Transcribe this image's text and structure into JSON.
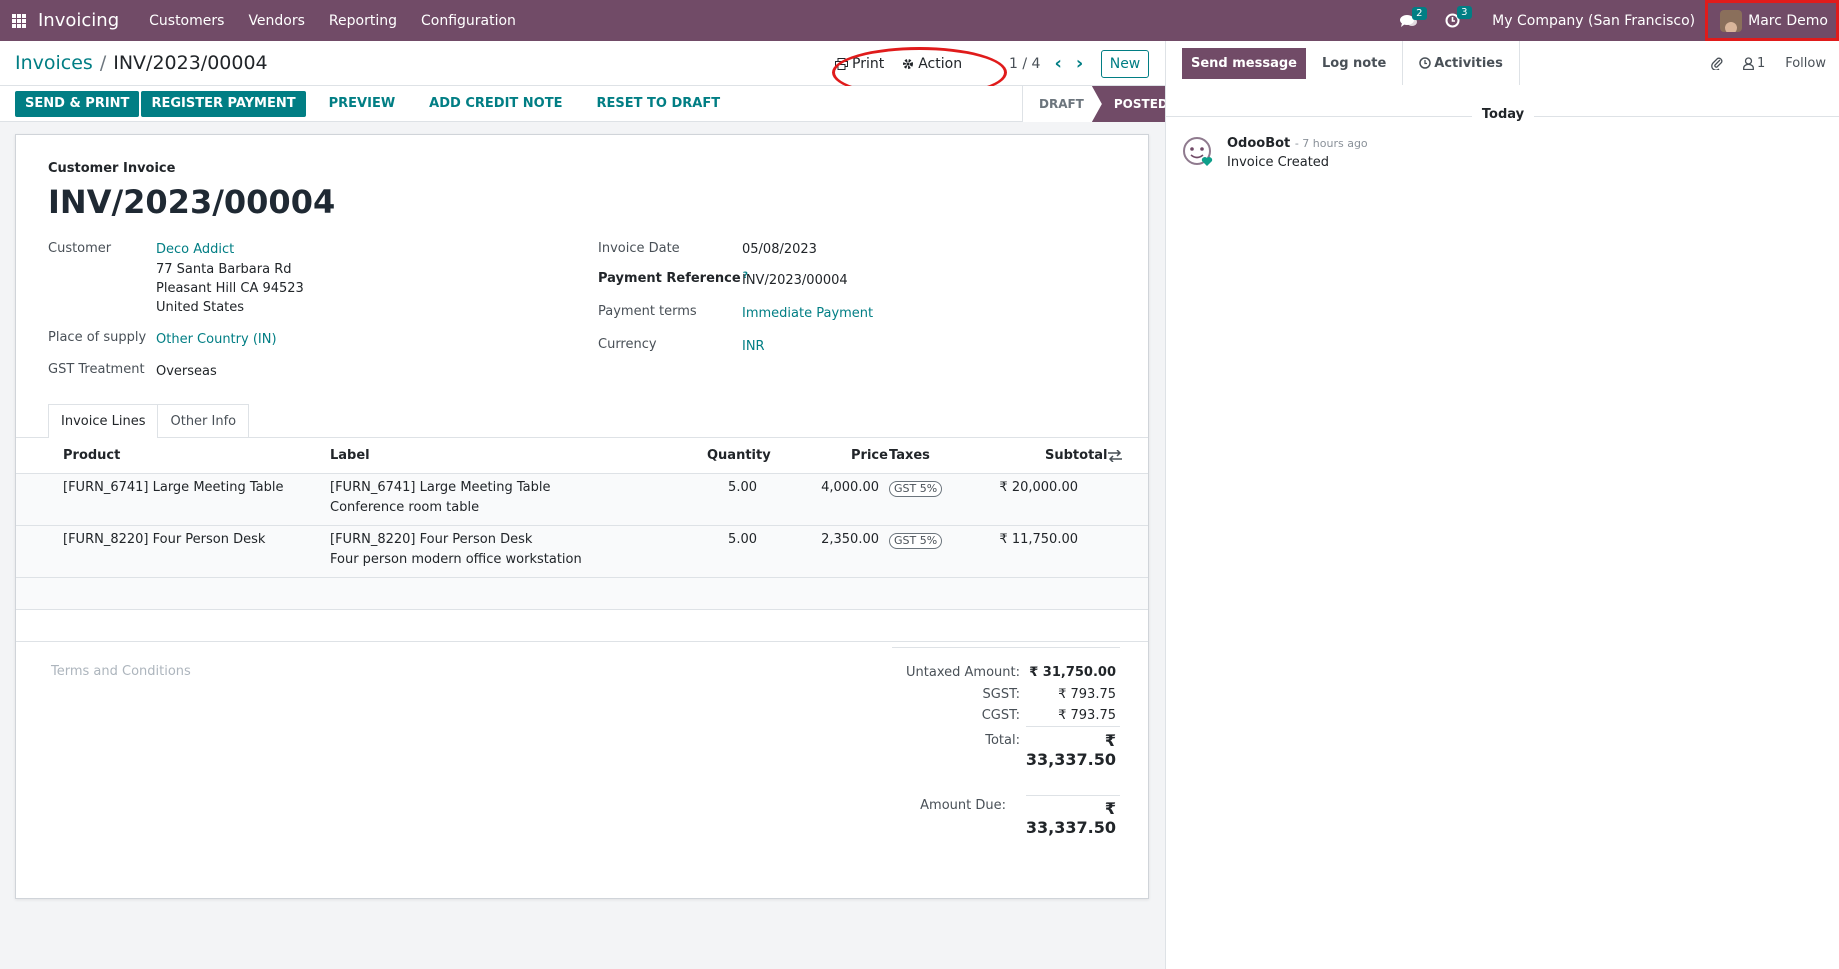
{
  "navbar": {
    "brand": "Invoicing",
    "menu": [
      "Customers",
      "Vendors",
      "Reporting",
      "Configuration"
    ],
    "messages_count": "2",
    "activities_count": "3",
    "company": "My Company (San Francisco)",
    "user": "Marc Demo"
  },
  "control": {
    "breadcrumb_parent": "Invoices",
    "breadcrumb_current": "INV/2023/00004",
    "print_label": "Print",
    "action_label": "Action",
    "pager": "1 / 4",
    "new_label": "New"
  },
  "statusbar": {
    "send_print": "SEND & PRINT",
    "register_payment": "REGISTER PAYMENT",
    "preview": "PREVIEW",
    "add_credit_note": "ADD CREDIT NOTE",
    "reset_to_draft": "RESET TO DRAFT",
    "states": [
      "DRAFT",
      "POSTED"
    ],
    "active_state": "POSTED"
  },
  "form": {
    "subtitle": "Customer Invoice",
    "title": "INV/2023/00004",
    "customer_label": "Customer",
    "customer_name": "Deco Addict",
    "customer_address": [
      "77 Santa Barbara Rd",
      "Pleasant Hill CA 94523",
      "United States"
    ],
    "place_of_supply_label": "Place of supply",
    "place_of_supply": "Other Country (IN)",
    "gst_treatment_label": "GST Treatment",
    "gst_treatment": "Overseas",
    "invoice_date_label": "Invoice Date",
    "invoice_date": "05/08/2023",
    "payment_reference_label": "Payment Reference",
    "payment_reference_help": "?",
    "payment_reference": "INV/2023/00004",
    "payment_terms_label": "Payment terms",
    "payment_terms": "Immediate Payment",
    "currency_label": "Currency",
    "currency": "INR"
  },
  "tabs": [
    "Invoice Lines",
    "Other Info"
  ],
  "lines": {
    "headers": [
      "Product",
      "Label",
      "Quantity",
      "Price",
      "Taxes",
      "Subtotal"
    ],
    "rows": [
      {
        "product": "[FURN_6741] Large Meeting Table",
        "label_line1": "[FURN_6741] Large Meeting Table",
        "label_line2": "Conference room table",
        "quantity": "5.00",
        "price": "4,000.00",
        "tax": "GST 5%",
        "subtotal": "₹ 20,000.00"
      },
      {
        "product": "[FURN_8220] Four Person Desk",
        "label_line1": "[FURN_8220] Four Person Desk",
        "label_line2": "Four person modern office workstation",
        "quantity": "5.00",
        "price": "2,350.00",
        "tax": "GST 5%",
        "subtotal": "₹ 11,750.00"
      }
    ]
  },
  "totals": {
    "terms_placeholder": "Terms and Conditions",
    "untaxed_label": "Untaxed Amount:",
    "untaxed_value": "₹ 31,750.00",
    "sgst_label": "SGST:",
    "sgst_value": "₹ 793.75",
    "cgst_label": "CGST:",
    "cgst_value": "₹ 793.75",
    "total_label": "Total:",
    "total_value": "₹ 33,337.50",
    "amount_due_label": "Amount Due:",
    "amount_due_value": "₹ 33,337.50"
  },
  "chatter": {
    "send_message": "Send message",
    "log_note": "Log note",
    "activities": "Activities",
    "followers_count": "1",
    "follow": "Follow",
    "date_separator": "Today",
    "author": "OdooBot",
    "time": "- 7 hours ago",
    "message": "Invoice Created"
  },
  "colors": {
    "brand": "#714b67",
    "accent": "#017e84",
    "highlight": "#e01b1b"
  }
}
